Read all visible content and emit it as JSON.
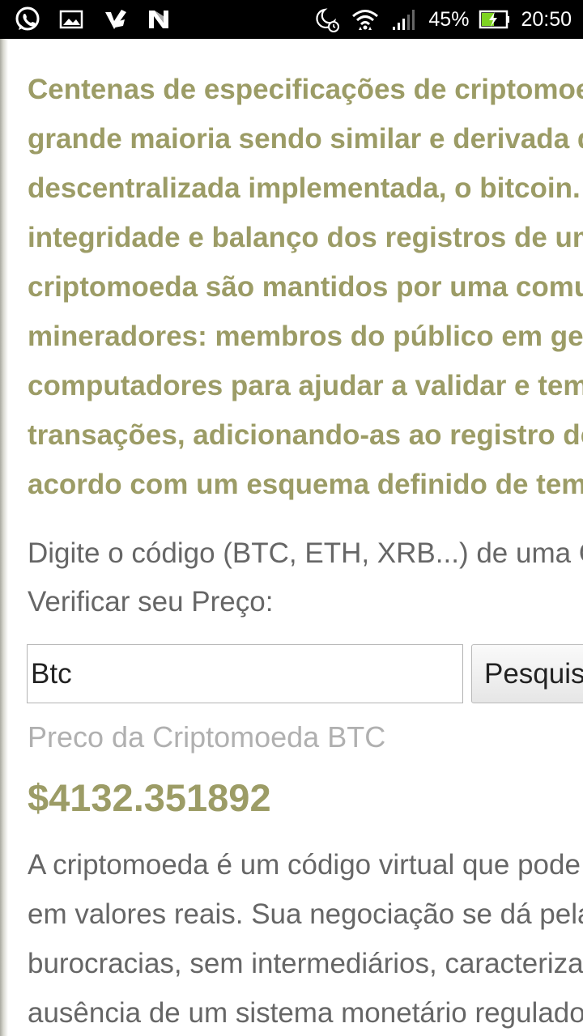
{
  "status_bar": {
    "battery_percent": "45%",
    "time": "20:50",
    "icons": [
      "whatsapp-icon",
      "gallery-icon",
      "checkmark-app-icon",
      "n-app-icon",
      "night-alarm-icon",
      "wifi-icon",
      "signal-icon",
      "battery-charging-icon"
    ]
  },
  "article": {
    "cut_text": "              ",
    "intro_lines": [
      "Centenas de especificações de criptomoedas existem, a",
      "grande maioria sendo similar e derivada da primeira",
      "descentralizada implementada, o bitcoin. A segurança,",
      "integridade e balanço dos registros de uma",
      "criptomoeda são mantidos por uma comunidade de",
      "mineradores: membros do público em geral usando seus",
      "computadores para ajudar a validar e temporizar as",
      "transações, adicionando-as ao registro de acordo",
      "acordo com um esquema definido de temporização."
    ]
  },
  "search": {
    "prompt_lines": [
      "Digite o código (BTC, ETH, XRB...) de uma Criptomoeda para",
      "Verificar seu Preço:"
    ],
    "input_value": "Btc",
    "button_label": "Pesquisar"
  },
  "result": {
    "label": "Preco da Criptomoeda BTC",
    "price": "$4132.351892"
  },
  "description": {
    "lines": [
      "A criptomoeda é um código virtual que pode ser convertido",
      "em valores reais. Sua negociação se dá pela internet, sem",
      "burocracias, sem intermediários, caracterizada pela",
      "ausência de um sistema monetário regulador."
    ]
  },
  "colors": {
    "accent_olive": "#9c9c66",
    "body_text": "#666666",
    "muted_text": "#b0b0b0",
    "status_bar_bg": "#000000",
    "battery_fill": "#7ed321"
  }
}
